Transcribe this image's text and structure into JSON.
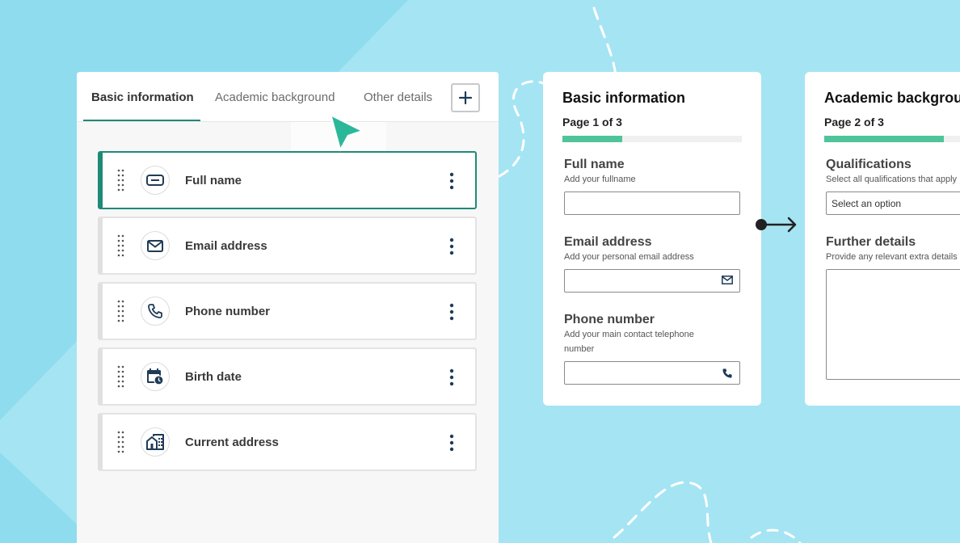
{
  "builder": {
    "tabs": [
      {
        "label": "Basic information",
        "active": true
      },
      {
        "label": "Academic background",
        "active": false
      },
      {
        "label": "Other details",
        "active": false
      }
    ],
    "add_tab_icon": "plus-icon",
    "fields": [
      {
        "label": "Full name",
        "icon": "text-field-icon",
        "selected": true
      },
      {
        "label": "Email address",
        "icon": "envelope-icon",
        "selected": false
      },
      {
        "label": "Phone number",
        "icon": "phone-icon",
        "selected": false
      },
      {
        "label": "Birth date",
        "icon": "calendar-clock-icon",
        "selected": false
      },
      {
        "label": "Current address",
        "icon": "building-icon",
        "selected": false
      }
    ]
  },
  "preview_1": {
    "title": "Basic information",
    "page": "Page 1 of 3",
    "progress": 0.333,
    "questions": [
      {
        "label": "Full name",
        "hint": "Add your fullname"
      },
      {
        "label": "Email address",
        "hint": "Add your personal email address"
      },
      {
        "label": "Phone number",
        "hint": "Add your main contact telephone number"
      }
    ]
  },
  "preview_2": {
    "title": "Academic background",
    "page": "Page 2 of 3",
    "progress": 0.667,
    "questions": [
      {
        "label": "Qualifications",
        "hint": "Select all qualifications that apply",
        "select_value": "Select an option"
      },
      {
        "label": "Further details",
        "hint": "Provide any relevant extra details"
      }
    ]
  },
  "colors": {
    "background": "#a5e4f3",
    "accent": "#1f8a78",
    "progress": "#4fc49a",
    "cursor": "#2bb89a",
    "icon": "#1f3b57"
  }
}
